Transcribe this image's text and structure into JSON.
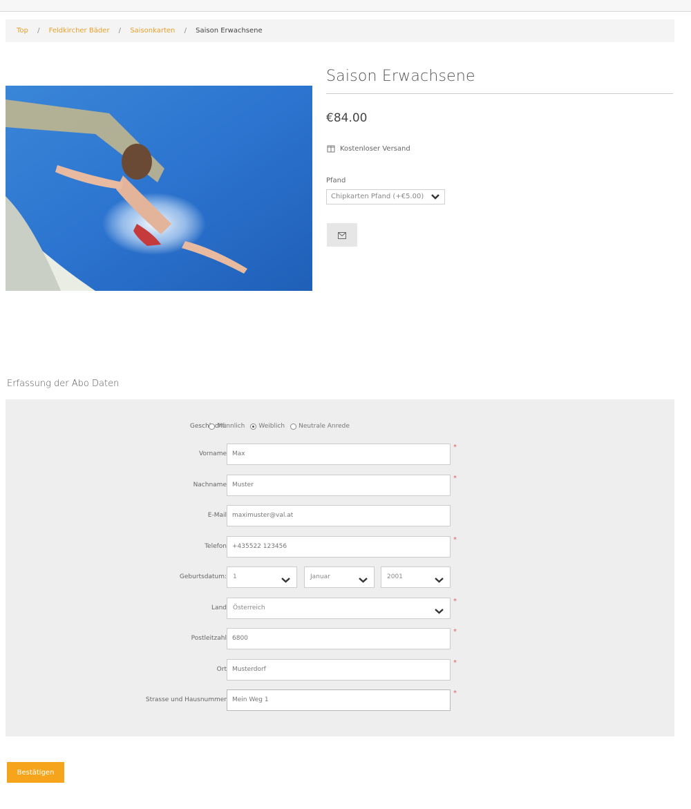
{
  "breadcrumb": {
    "items": [
      "Top",
      "Feldkircher Bäder",
      "Saisonkarten"
    ],
    "current": "Saison Erwachsene"
  },
  "product": {
    "title": "Saison Erwachsene",
    "price": "€84.00",
    "shipping": "Kostenloser Versand",
    "pfand_label": "Pfand",
    "pfand_value": "Chipkarten Pfand (+€5.00)"
  },
  "form": {
    "section_title": "Erfassung der Abo Daten",
    "gender": {
      "label": "Geschlecht:",
      "options": [
        "Männlich",
        "Weiblich",
        "Neutrale Anrede"
      ],
      "selected": "Weiblich"
    },
    "vorname": {
      "label": "Vorname",
      "value": "Max"
    },
    "nachname": {
      "label": "Nachname",
      "value": "Muster"
    },
    "email": {
      "label": "E-Mail",
      "value": "maximuster@val.at"
    },
    "telefon": {
      "label": "Telefon",
      "value": "+435522 123456"
    },
    "geburtsdatum": {
      "label": "Geburtsdatum:",
      "day": "1",
      "month": "Januar",
      "year": "2001"
    },
    "land": {
      "label": "Land",
      "value": "Österreich"
    },
    "postleitzahl": {
      "label": "Postleitzahl",
      "value": "6800"
    },
    "ort": {
      "label": "Ort",
      "value": "Musterdorf"
    },
    "strasse": {
      "label": "Strasse und Hausnummer",
      "value": "Mein Weg 1"
    },
    "required_marker": "*"
  },
  "actions": {
    "confirm_label": "Bestätigen"
  },
  "icons": {
    "shipping": "package-icon",
    "mail": "mail-icon",
    "select": "chevron-down-icon"
  },
  "colors": {
    "accent": "#f5a41c",
    "required": "#e06060",
    "panel": "#eeeeee"
  }
}
